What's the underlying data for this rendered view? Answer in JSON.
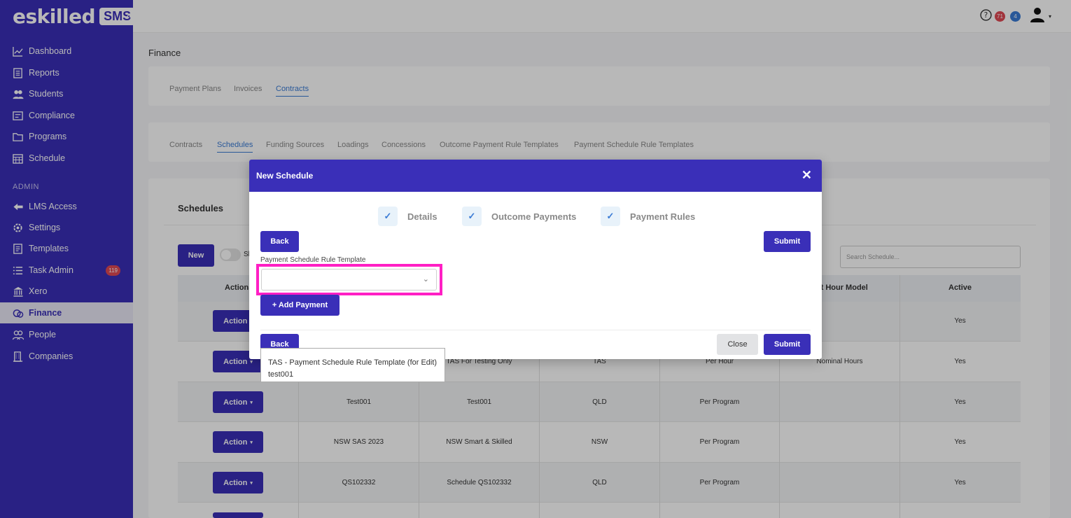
{
  "brand": {
    "logo_text": "eskilled",
    "logo_badge": "SMS"
  },
  "sidebar": {
    "items": [
      {
        "label": "Dashboard",
        "icon": "chart-line-icon"
      },
      {
        "label": "Reports",
        "icon": "report-icon"
      },
      {
        "label": "Students",
        "icon": "students-icon"
      },
      {
        "label": "Compliance",
        "icon": "compliance-icon"
      },
      {
        "label": "Programs",
        "icon": "programs-icon"
      },
      {
        "label": "Schedule",
        "icon": "calendar-icon"
      }
    ],
    "section_label": "ADMIN",
    "admin_items": [
      {
        "label": "LMS Access",
        "icon": "lms-icon"
      },
      {
        "label": "Settings",
        "icon": "gear-icon"
      },
      {
        "label": "Templates",
        "icon": "template-icon"
      },
      {
        "label": "Task Admin",
        "icon": "list-icon",
        "badge": "119"
      },
      {
        "label": "Xero",
        "icon": "bank-icon"
      },
      {
        "label": "Finance",
        "icon": "finance-icon",
        "active": true
      },
      {
        "label": "People",
        "icon": "people-icon"
      },
      {
        "label": "Companies",
        "icon": "building-icon"
      }
    ]
  },
  "topbar": {
    "help_icon": "help-icon",
    "badge_red": "71",
    "badge_blue": "4",
    "user_icon": "user-icon"
  },
  "page": {
    "title": "Finance",
    "main_tabs": [
      "Payment Plans",
      "Invoices",
      "Contracts"
    ],
    "sub_tabs": [
      "Contracts",
      "Schedules",
      "Funding Sources",
      "Loadings",
      "Concessions",
      "Outcome Payment Rule Templates",
      "Payment Schedule Rule Templates"
    ]
  },
  "schedules": {
    "title": "Schedules",
    "new_label": "New",
    "toggle_label_partial": "Sl",
    "search_placeholder": "Search Schedule...",
    "headers": {
      "actions": "Actions",
      "payment_hour_model": "ment Hour Model",
      "active": "Active"
    },
    "action_label": "Action",
    "rows": [
      {
        "name": "",
        "desc": "",
        "state": "",
        "type": "",
        "model": "",
        "active": "Yes"
      },
      {
        "name": "",
        "desc": "TAS For Testing Only",
        "state": "TAS",
        "type": "Per Hour",
        "model": "Nominal Hours",
        "active": "Yes"
      },
      {
        "name": "Test001",
        "desc": "Test001",
        "state": "QLD",
        "type": "Per Program",
        "model": "",
        "active": "Yes"
      },
      {
        "name": "NSW SAS 2023",
        "desc": "NSW Smart & Skilled",
        "state": "NSW",
        "type": "Per Program",
        "model": "",
        "active": "Yes"
      },
      {
        "name": "QS102332",
        "desc": "Schedule QS102332",
        "state": "QLD",
        "type": "Per Program",
        "model": "",
        "active": "Yes"
      }
    ]
  },
  "modal": {
    "title": "New Schedule",
    "steps": [
      "Details",
      "Outcome Payments",
      "Payment Rules"
    ],
    "back_label": "Back",
    "submit_label": "Submit",
    "close_label": "Close",
    "field_label": "Payment Schedule Rule Template",
    "add_payment_label": "+ Add Payment",
    "select_value": ""
  },
  "dropdown": {
    "options": [
      "TAS - Payment Schedule Rule Template (for Edit)",
      "test001"
    ]
  },
  "colors": {
    "primary": "#3a2fb8",
    "highlight": "#ff1fc4",
    "tab_active": "#3a7bd5"
  }
}
